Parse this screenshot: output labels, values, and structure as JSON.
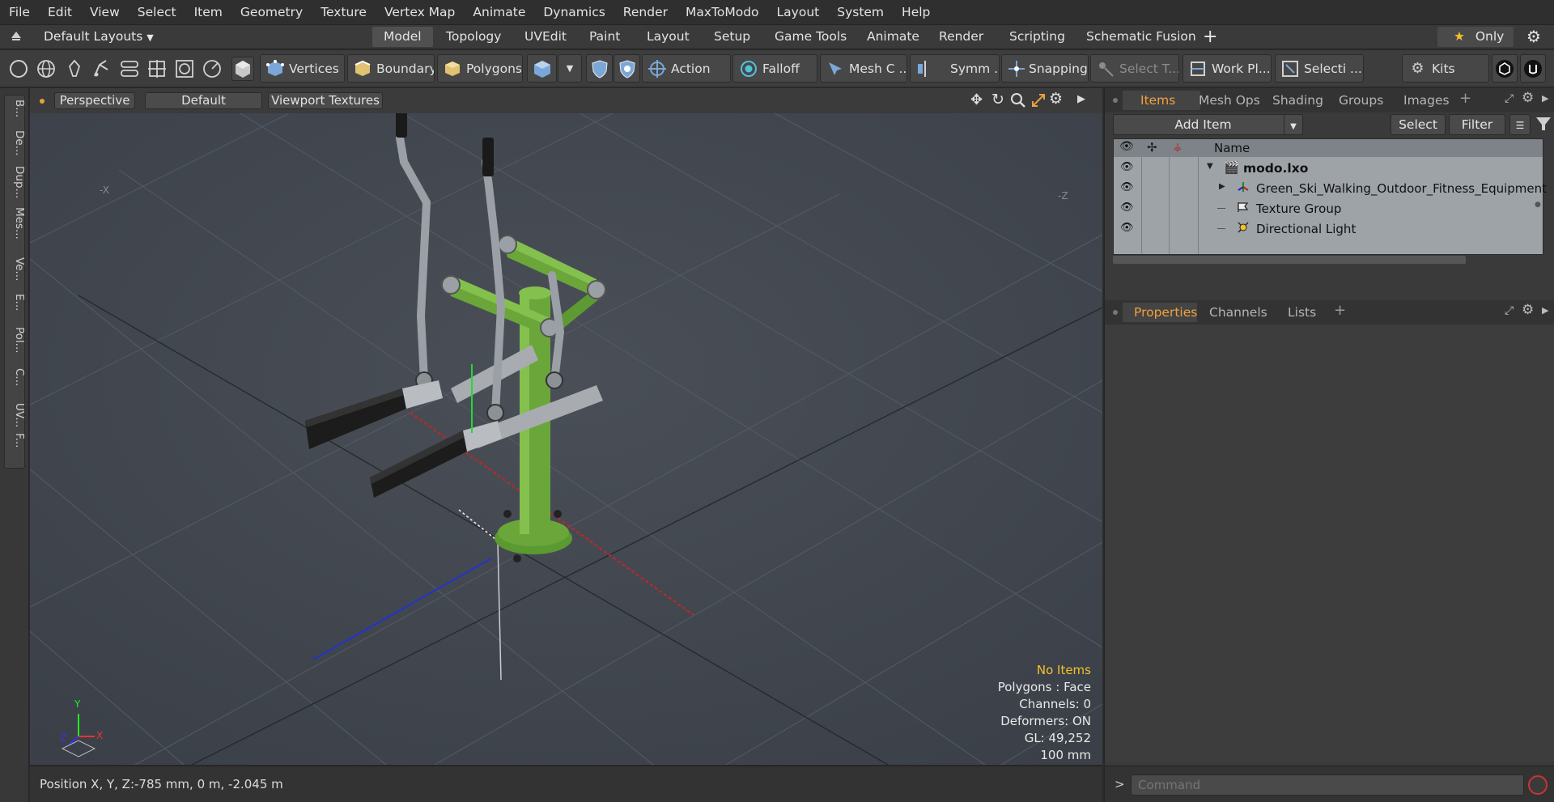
{
  "menu": [
    "File",
    "Edit",
    "View",
    "Select",
    "Item",
    "Geometry",
    "Texture",
    "Vertex Map",
    "Animate",
    "Dynamics",
    "Render",
    "MaxToModo",
    "Layout",
    "System",
    "Help"
  ],
  "layoutbar": {
    "layouts_label": "Default Layouts",
    "tabs": [
      "Model",
      "Topology",
      "UVEdit",
      "Paint",
      "Layout",
      "Setup",
      "Game Tools",
      "Animate",
      "Render",
      "Scripting",
      "Schematic Fusion"
    ],
    "active_tab": "Model",
    "only_label": "Only"
  },
  "toolbar": {
    "vertices": "Vertices",
    "boundary": "Boundary",
    "polygons": "Polygons",
    "action": "Action",
    "action_more": "...",
    "falloff": "Falloff",
    "mesh_c": "Mesh C ...",
    "symm": "Symm ...",
    "snapping": "Snapping",
    "select_t": "Select T...",
    "work_pl": "Work Pl...",
    "selecti": "Selecti ...",
    "kits": "Kits"
  },
  "left_strip": [
    "B...",
    "De...",
    "Dup...",
    "Mes...",
    "Ve...",
    "E...",
    "Pol...",
    "C...",
    "UV...",
    "F..."
  ],
  "viewport": {
    "view_label": "Perspective",
    "shading_label": "Default",
    "textures_label": "Viewport Textures",
    "axis_x_label": "-X",
    "axis_z_label": "-Z",
    "overlay": {
      "no_items": "No Items",
      "polygons": "Polygons : Face",
      "channels": "Channels: 0",
      "deformers": "Deformers: ON",
      "gl": "GL: 49,252",
      "scale": "100 mm"
    },
    "gizmo": {
      "y": "Y",
      "x": "X",
      "z": "Z"
    }
  },
  "status": {
    "position_label": "Position X, Y, Z:",
    "position_value": "-785 mm, 0 m, -2.045 m"
  },
  "items_panel": {
    "tabs": [
      "Items",
      "Mesh Ops",
      "Shading",
      "Groups",
      "Images"
    ],
    "active_tab": "Items",
    "add_item": "Add Item",
    "select": "Select",
    "filter": "Filter",
    "name_header": "Name",
    "rows": [
      {
        "label": "modo.lxo",
        "bold": true
      },
      {
        "label": "Green_Ski_Walking_Outdoor_Fitness_Equipment",
        "bold": false
      },
      {
        "label": "Texture Group",
        "bold": false
      },
      {
        "label": "Directional Light",
        "bold": false
      }
    ]
  },
  "properties_panel": {
    "tabs": [
      "Properties",
      "Channels",
      "Lists"
    ],
    "active_tab": "Properties"
  },
  "command": {
    "prompt": ">",
    "placeholder": "Command"
  },
  "colors": {
    "accent": "#f2a13c",
    "equipment_green": "#6aa63a",
    "viewport_bg": "#41464e"
  }
}
